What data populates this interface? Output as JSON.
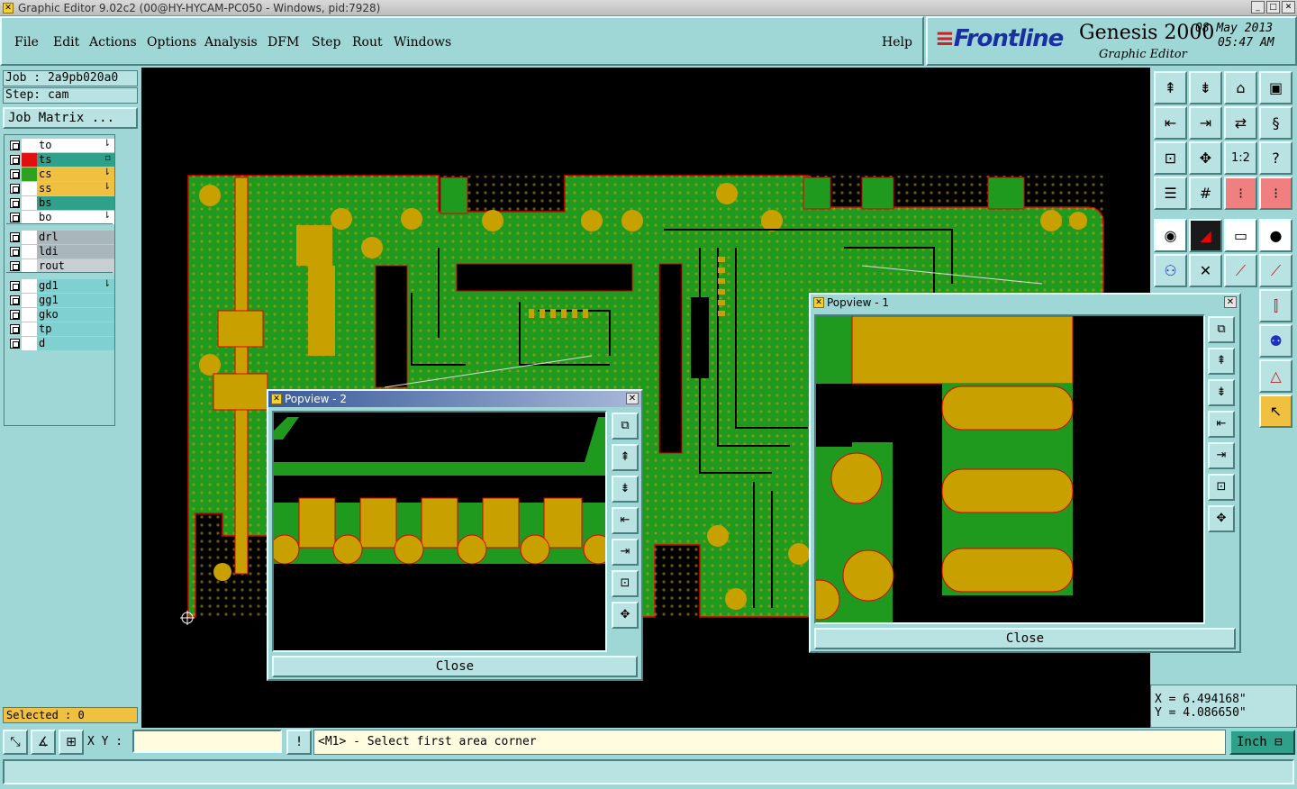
{
  "window": {
    "title": "Graphic Editor 9.02c2 (00@HY-HYCAM-PC050 - Windows, pid:7928)"
  },
  "menu": [
    "File",
    "Edit",
    "Actions",
    "Options",
    "Analysis",
    "DFM",
    "Step",
    "Rout",
    "Windows"
  ],
  "help": "Help",
  "header": {
    "brand": "Frontline",
    "product": "Genesis 2000",
    "subtitle": "Graphic Editor",
    "date": "08 May 2013",
    "time": "05:47 AM"
  },
  "job": {
    "job_label": "Job : 2a9pb020a0",
    "step_label": "Step: cam",
    "matrix_button": "Job Matrix ..."
  },
  "layers": [
    {
      "name": "to",
      "bg": "#ffffff",
      "swatch": "#ffffff",
      "mark": "⇂"
    },
    {
      "name": "ts",
      "bg": "#2fa08a",
      "swatch": "#e01010",
      "mark": "▫"
    },
    {
      "name": "cs",
      "bg": "#f0c040",
      "swatch": "#2fa020",
      "mark": "⇂"
    },
    {
      "name": "ss",
      "bg": "#f0c040",
      "swatch": "#ffffff",
      "mark": "⇂"
    },
    {
      "name": "bs",
      "bg": "#2fa08a",
      "swatch": "#ffffff",
      "mark": ""
    },
    {
      "name": "bo",
      "bg": "#ffffff",
      "swatch": "#ffffff",
      "mark": "⇂"
    },
    {
      "name": "drl",
      "bg": "#a9b6bb",
      "swatch": "#ffffff",
      "mark": ""
    },
    {
      "name": "ldi",
      "bg": "#a9b6bb",
      "swatch": "#ffffff",
      "mark": ""
    },
    {
      "name": "rout",
      "bg": "#c8d0d4",
      "swatch": "#ffffff",
      "mark": ""
    },
    {
      "name": "gd1",
      "bg": "#7fd0d0",
      "swatch": "#ffffff",
      "mark": "⇂"
    },
    {
      "name": "gg1",
      "bg": "#7fd0d0",
      "swatch": "#ffffff",
      "mark": ""
    },
    {
      "name": "gko",
      "bg": "#7fd0d0",
      "swatch": "#ffffff",
      "mark": ""
    },
    {
      "name": "tp",
      "bg": "#7fd0d0",
      "swatch": "#ffffff",
      "mark": ""
    },
    {
      "name": "d",
      "bg": "#7fd0d0",
      "swatch": "#ffffff",
      "mark": ""
    }
  ],
  "selected": "Selected : 0",
  "coords": {
    "x": "X = 6.494168\"",
    "y": "Y = 4.086650\""
  },
  "status": {
    "xy_label": "X Y :",
    "xy_value": "",
    "prompt": "<M1> - Select first area corner",
    "unit": "Inch"
  },
  "popview1": {
    "title": "Popview - 1",
    "close": "Close"
  },
  "popview2": {
    "title": "Popview - 2",
    "close": "Close"
  },
  "colors": {
    "copper": "#1f9a1f",
    "pad": "#c8a000",
    "outline": "#e00000",
    "panel": "#9fd6d6"
  }
}
